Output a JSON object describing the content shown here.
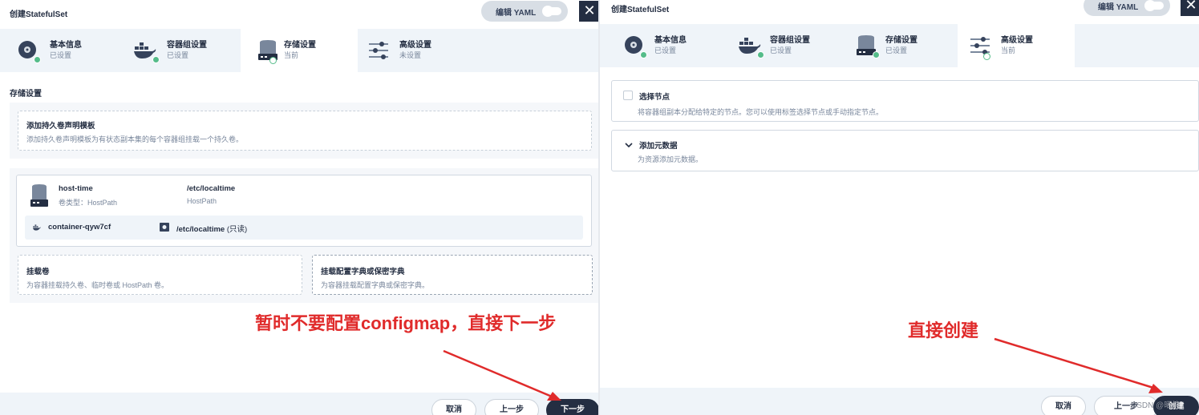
{
  "left": {
    "title": "创建StatefulSet",
    "yaml_label": "编辑 YAML",
    "tabs": [
      {
        "name": "基本信息",
        "status": "已设置"
      },
      {
        "name": "容器组设置",
        "status": "已设置"
      },
      {
        "name": "存储设置",
        "status": "当前"
      },
      {
        "name": "高级设置",
        "status": "未设置"
      }
    ],
    "section_title": "存储设置",
    "pvc_card": {
      "title": "添加持久卷声明模板",
      "desc": "添加持久卷声明模板为有状态副本集的每个容器组挂载一个持久卷。"
    },
    "volume": {
      "name": "host-time",
      "type": "卷类型：HostPath",
      "path": "/etc/localtime",
      "path_type": "HostPath",
      "container": "container-qyw7cf",
      "mount_path": "/etc/localtime",
      "mount_mode": "(只读)"
    },
    "mount_volume": {
      "title": "挂载卷",
      "desc": "为容器挂载持久卷、临时卷或 HostPath 卷。"
    },
    "mount_config": {
      "title": "挂载配置字典或保密字典",
      "desc": "为容器挂载配置字典或保密字典。"
    },
    "annotation": "暂时不要配置configmap，直接下一步",
    "buttons": {
      "cancel": "取消",
      "prev": "上一步",
      "next": "下一步"
    }
  },
  "right": {
    "title": "创建StatefulSet",
    "yaml_label": "编辑 YAML",
    "tabs": [
      {
        "name": "基本信息",
        "status": "已设置"
      },
      {
        "name": "容器组设置",
        "status": "已设置"
      },
      {
        "name": "存储设置",
        "status": "已设置"
      },
      {
        "name": "高级设置",
        "status": "当前"
      }
    ],
    "node_select": {
      "title": "选择节点",
      "desc": "将容器组副本分配给特定的节点。您可以使用标签选择节点或手动指定节点。"
    },
    "metadata": {
      "title": "添加元数据",
      "desc": "为资源添加元数据。"
    },
    "annotation": "直接创建",
    "buttons": {
      "cancel": "取消",
      "prev": "上一步",
      "create": "创建"
    },
    "watermark": "CSDN @晒竹"
  },
  "colors": {
    "accent_green": "#55bc8a",
    "dark": "#242e42",
    "annotation_red": "#e02b2b",
    "tab_bg": "#eff4f9"
  }
}
